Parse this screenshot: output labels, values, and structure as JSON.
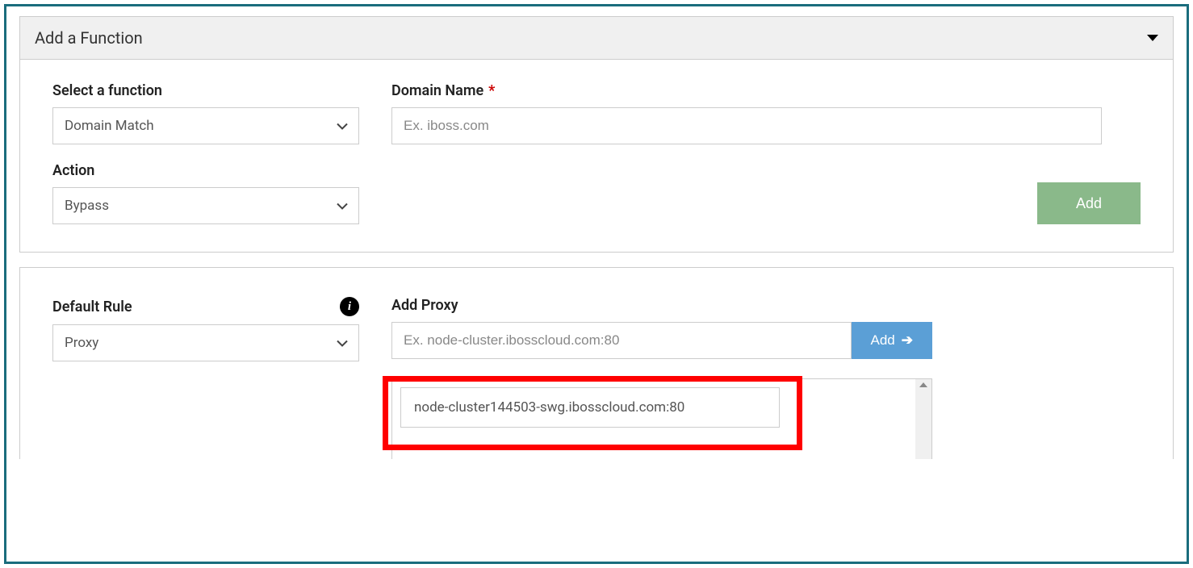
{
  "panel1": {
    "title": "Add a Function",
    "function_field": {
      "label": "Select a function",
      "value": "Domain Match"
    },
    "domain_field": {
      "label": "Domain Name",
      "placeholder": "Ex. iboss.com"
    },
    "action_field": {
      "label": "Action",
      "value": "Bypass"
    },
    "add_button": "Add"
  },
  "panel2": {
    "default_rule": {
      "label": "Default Rule",
      "value": "Proxy"
    },
    "add_proxy": {
      "label": "Add Proxy",
      "placeholder": "Ex. node-cluster.ibosscloud.com:80",
      "button": "Add"
    },
    "proxy_list": [
      "node-cluster144503-swg.ibosscloud.com:80"
    ]
  }
}
